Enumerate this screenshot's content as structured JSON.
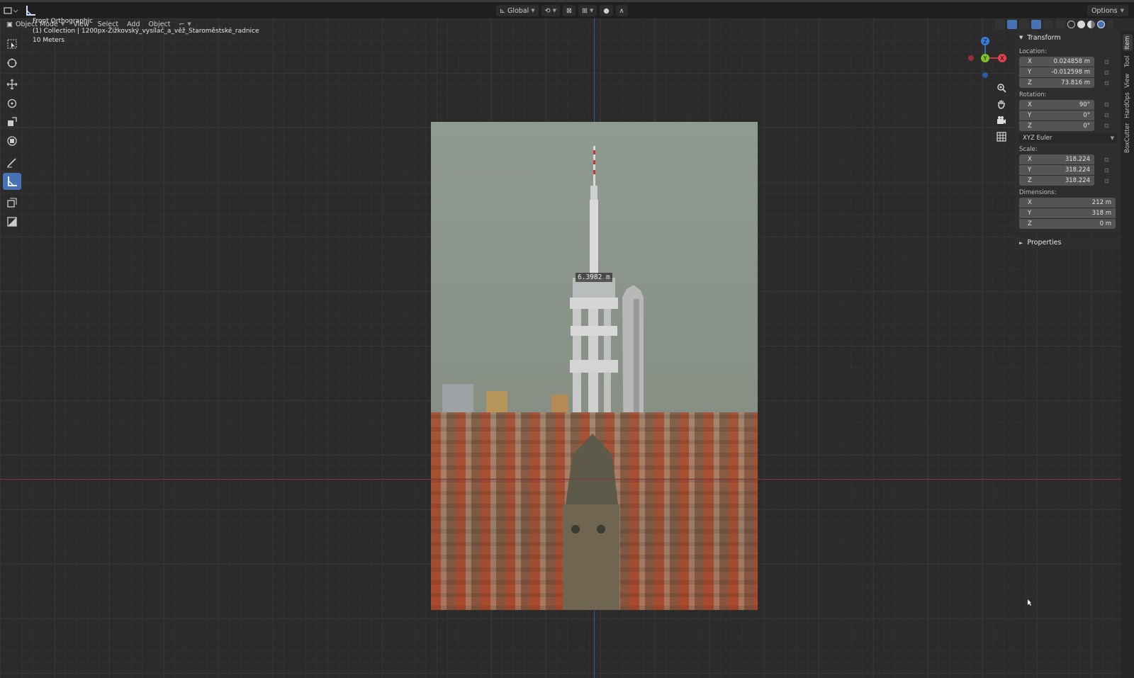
{
  "header": {
    "orientation": "Global",
    "options_label": "Options"
  },
  "viewport_header": {
    "mode": "Object Mode",
    "menus": [
      "View",
      "Select",
      "Add",
      "Object"
    ]
  },
  "overlay": {
    "view_name": "Front Orthographic",
    "collection": "(1) Collection | 1200px-Žižkovský_vysílač_a_věž_Staroměstské_radnice",
    "scale": "10 Meters"
  },
  "gizmo": {
    "x": "X",
    "y": "Y",
    "z": "Z"
  },
  "measure_label": "6.3982 m",
  "npanel": {
    "transform_title": "Transform",
    "location_label": "Location:",
    "location": [
      {
        "axis": "X",
        "value": "0.024858 m"
      },
      {
        "axis": "Y",
        "value": "-0.012598 m"
      },
      {
        "axis": "Z",
        "value": "73.816 m"
      }
    ],
    "rotation_label": "Rotation:",
    "rotation": [
      {
        "axis": "X",
        "value": "90°"
      },
      {
        "axis": "Y",
        "value": "0°"
      },
      {
        "axis": "Z",
        "value": "0°"
      }
    ],
    "rotation_mode": "XYZ Euler",
    "scale_label": "Scale:",
    "scale": [
      {
        "axis": "X",
        "value": "318.224"
      },
      {
        "axis": "Y",
        "value": "318.224"
      },
      {
        "axis": "Z",
        "value": "318.224"
      }
    ],
    "dimensions_label": "Dimensions:",
    "dimensions": [
      {
        "axis": "X",
        "value": "212 m"
      },
      {
        "axis": "Y",
        "value": "318 m"
      },
      {
        "axis": "Z",
        "value": "0 m"
      }
    ],
    "properties_title": "Properties"
  },
  "tabs": [
    "Item",
    "Tool",
    "View",
    "HardOps",
    "BoxCutter"
  ],
  "colors": {
    "accent": "#4772b3",
    "axis_x": "#e0424f",
    "axis_y": "#7ec32c",
    "axis_z": "#3b7ee0"
  }
}
